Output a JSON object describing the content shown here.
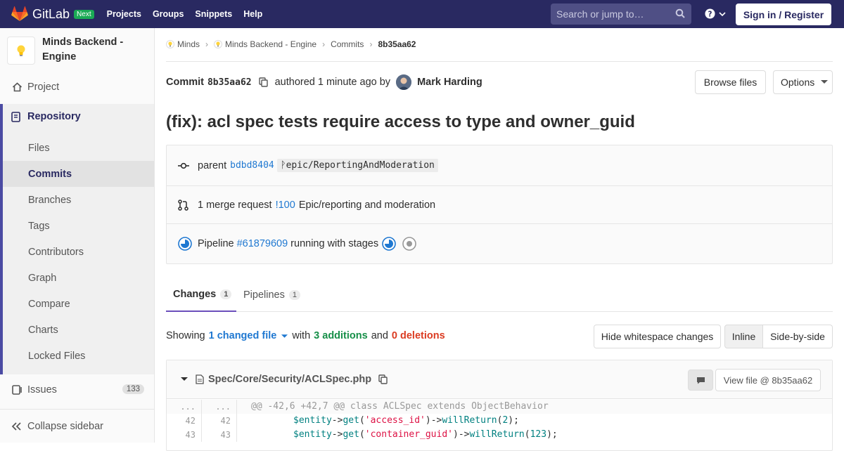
{
  "navbar": {
    "brand": "GitLab",
    "badge": "Next",
    "links": [
      "Projects",
      "Groups",
      "Snippets",
      "Help"
    ],
    "search_placeholder": "Search or jump to…",
    "signin": "Sign in / Register"
  },
  "sidebar": {
    "project_name": "Minds Backend - Engine",
    "project": "Project",
    "repository": "Repository",
    "repo_items": [
      "Files",
      "Commits",
      "Branches",
      "Tags",
      "Contributors",
      "Graph",
      "Compare",
      "Charts",
      "Locked Files"
    ],
    "issues": "Issues",
    "issues_count": "133",
    "collapse": "Collapse sidebar"
  },
  "breadcrumb": {
    "group": "Minds",
    "project": "Minds Backend - Engine",
    "section": "Commits",
    "current": "8b35aa62"
  },
  "commit": {
    "label": "Commit",
    "sha": "8b35aa62",
    "authored": "authored 1 minute ago by",
    "author": "Mark Harding",
    "browse_files": "Browse files",
    "options": "Options",
    "title": "(fix): acl spec tests require access to type and owner_guid"
  },
  "info": {
    "parent_label": "parent",
    "parent_sha": "bdbd8404",
    "branch": "epic/ReportingAndModeration",
    "mr_text": "1 merge request",
    "mr_link": "!100",
    "mr_title": "Epic/reporting and moderation",
    "pipeline_label": "Pipeline",
    "pipeline_link": "#61879609",
    "pipeline_status": "running with stages"
  },
  "tabs": {
    "changes": "Changes",
    "changes_count": "1",
    "pipelines": "Pipelines",
    "pipelines_count": "1"
  },
  "summary": {
    "showing": "Showing",
    "changed": "1 changed file",
    "with": "with",
    "additions": "3 additions",
    "and": "and",
    "deletions": "0 deletions",
    "hide_ws": "Hide whitespace changes",
    "inline": "Inline",
    "side_by_side": "Side-by-side"
  },
  "file": {
    "path": "Spec/Core/Security/ACLSpec.php",
    "view_file": "View file @ 8b35aa62",
    "hunk_ln": "...",
    "hunk": "@@ -42,6 +42,7 @@ class ACLSpec extends ObjectBehavior",
    "rows": [
      {
        "old": "42",
        "new": "42",
        "var": "$entity",
        "arrow1": "->",
        "fn1": "get",
        "open1": "(",
        "str": "'access_id'",
        "close1": ")",
        "arrow2": "->",
        "fn2": "willReturn",
        "open2": "(",
        "num": "2",
        "close2": ");"
      },
      {
        "old": "43",
        "new": "43",
        "var": "$entity",
        "arrow1": "->",
        "fn1": "get",
        "open1": "(",
        "str": "'container_guid'",
        "close1": ")",
        "arrow2": "->",
        "fn2": "willReturn",
        "open2": "(",
        "num": "123",
        "close2": ");"
      }
    ]
  },
  "colors": {
    "navbar": "#292961",
    "accent": "#1f78d1",
    "additions": "#168f48",
    "deletions": "#db3b21"
  }
}
